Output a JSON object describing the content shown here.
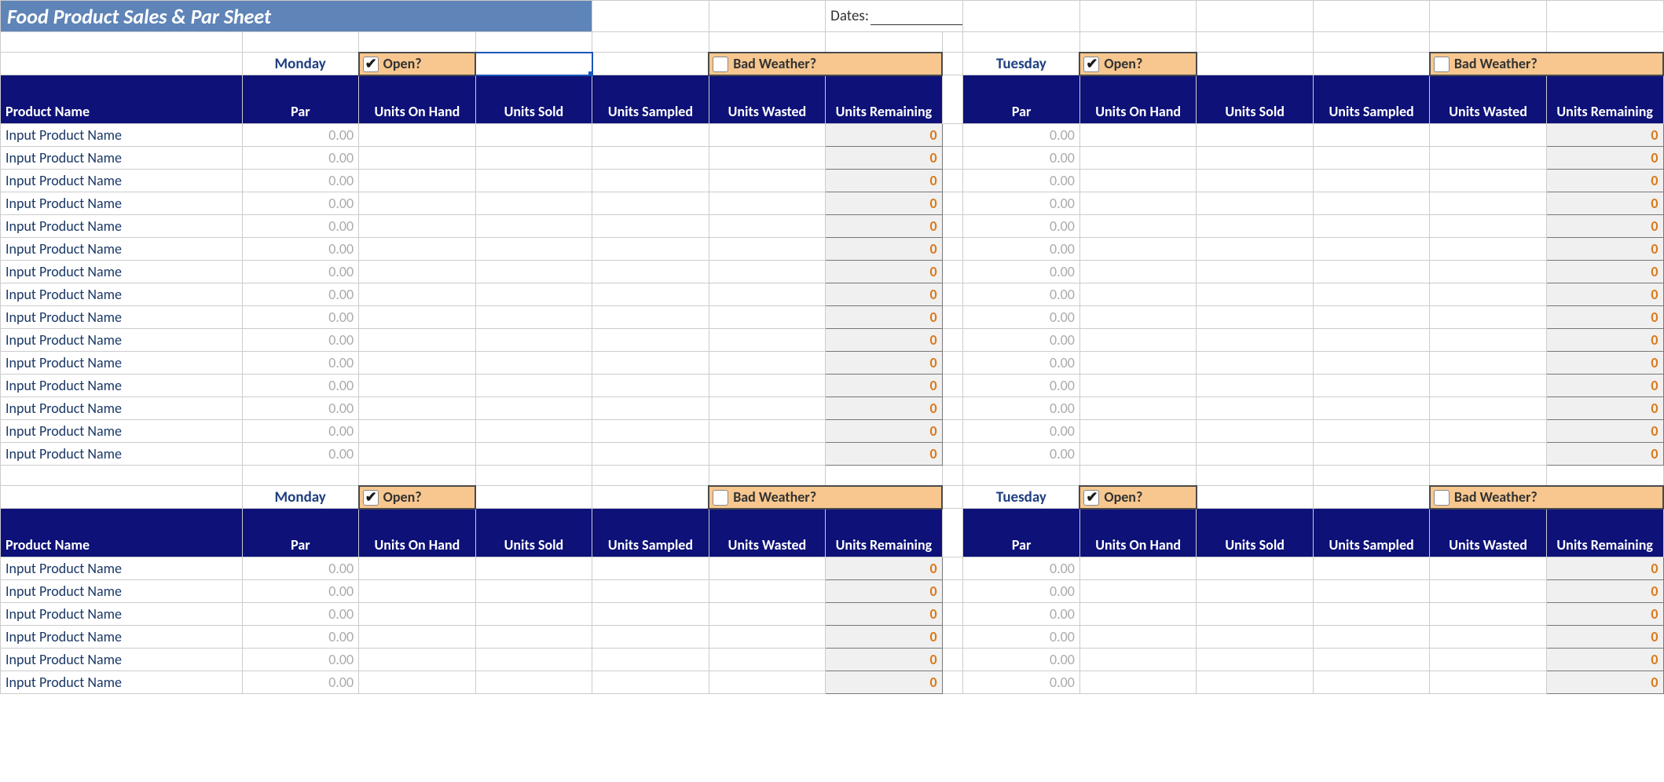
{
  "title": "Food Product Sales & Par Sheet",
  "dates_label": "Dates:",
  "days": {
    "monday": "Monday",
    "tuesday": "Tuesday"
  },
  "checkbox_labels": {
    "open": "Open?",
    "bad_weather": "Bad Weather?"
  },
  "headers": {
    "product_name": "Product Name",
    "par": "Par",
    "on_hand": "Units On Hand",
    "sold": "Units Sold",
    "sampled": "Units Sampled",
    "wasted": "Units Wasted",
    "remaining": "Units Remaining"
  },
  "placeholder_name": "Input Product Name",
  "par_default": "0.00",
  "remain_default": "0",
  "section1_rows": 15,
  "section2_rows": 6
}
